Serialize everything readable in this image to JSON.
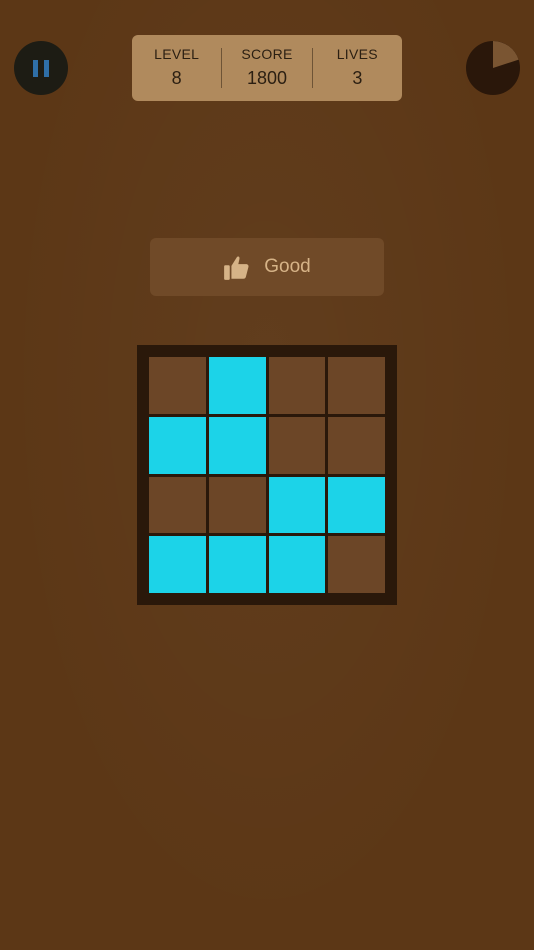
{
  "hud": {
    "level": {
      "label": "LEVEL",
      "value": "8"
    },
    "score": {
      "label": "SCORE",
      "value": "1800"
    },
    "lives": {
      "label": "LIVES",
      "value": "3"
    }
  },
  "timer": {
    "elapsed_fraction": 0.2
  },
  "feedback": {
    "icon": "thumbs-up-icon",
    "text": "Good"
  },
  "board": {
    "rows": 4,
    "cols": 4,
    "cells": [
      [
        0,
        1,
        0,
        0
      ],
      [
        1,
        1,
        0,
        0
      ],
      [
        0,
        0,
        1,
        1
      ],
      [
        1,
        1,
        1,
        0
      ]
    ]
  },
  "colors": {
    "background": "#5c3716",
    "active_tile": "#1cd3e8",
    "inactive_tile": "#6c4627",
    "board_frame": "#2a180a",
    "panel": "#b08a5d",
    "pause_icon": "#2f6fa7"
  }
}
